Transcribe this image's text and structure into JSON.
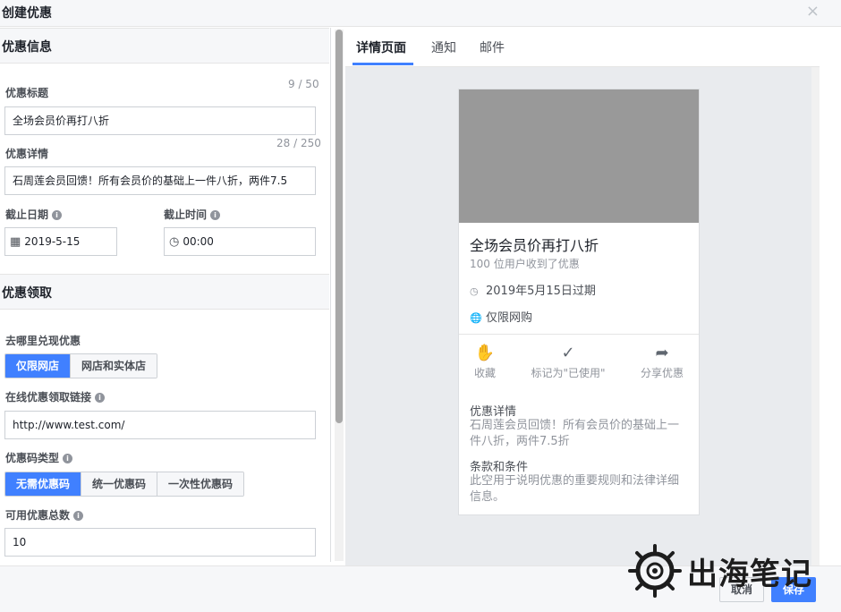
{
  "dialog": {
    "title": "创建优惠",
    "close_glyph": "×"
  },
  "left": {
    "section1": "优惠信息",
    "title_label": "优惠标题",
    "title_counter": "9 / 50",
    "title_value": "全场会员价再打八折",
    "detail_label": "优惠详情",
    "detail_counter": "28 / 250",
    "detail_value": "石周莲会员回馈！所有会员价的基础上一件八折，两件7.5",
    "end_date_label": "截止日期",
    "end_date_value": "2019-5-15",
    "end_time_label": "截止时间",
    "end_time_value": "00:00",
    "section2": "优惠领取",
    "where_label": "去哪里兑现优惠",
    "where_options": [
      "仅限网店",
      "网店和实体店"
    ],
    "link_label": "在线优惠领取链接",
    "link_value": "http://www.test.com/",
    "code_type_label": "优惠码类型",
    "code_options": [
      "无需优惠码",
      "统一优惠码",
      "一次性优惠码"
    ],
    "total_label": "可用优惠总数",
    "total_value": "10"
  },
  "tabs": [
    "详情页面",
    "通知",
    "邮件"
  ],
  "card": {
    "title": "全场会员价再打八折",
    "subtitle": "100 位用户收到了优惠",
    "expiry": "2019年5月15日过期",
    "scope": "仅限网购",
    "actions": [
      "收藏",
      "标记为\"已使用\"",
      "分享优惠"
    ],
    "detail_heading": "优惠详情",
    "detail_text": "石周莲会员回馈！所有会员价的基础上一件八折，两件7.5折",
    "terms_heading": "条款和条件",
    "terms_text": "此空用于说明优惠的重要规则和法律详细信息。"
  },
  "footer": {
    "cancel": "取消",
    "save": "保存"
  },
  "watermark": {
    "text": "出海笔记"
  },
  "colors": {
    "accent": "#4080ff",
    "panel": "#f6f7f9",
    "preview_bg": "#e9ebee"
  },
  "icons": [
    "close-icon",
    "info-icon",
    "calendar-icon",
    "clock-icon",
    "clock-outline-icon",
    "globe-icon",
    "save-hand-icon",
    "check-icon",
    "share-arrow-icon",
    "ship-wheel-icon"
  ]
}
